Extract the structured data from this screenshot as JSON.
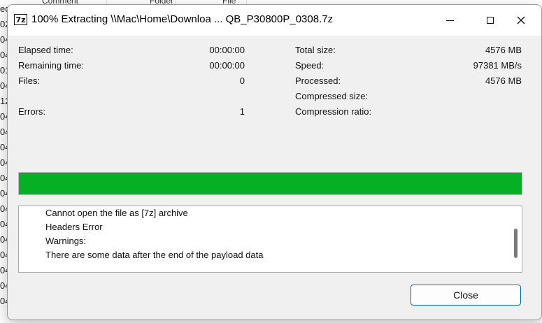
{
  "background_window": {
    "header": [
      "Comment",
      "Folder",
      "File"
    ],
    "row_fragments": [
      "ed",
      "02",
      "04",
      "04",
      "01",
      "04",
      "12",
      "04",
      "04",
      "04",
      "04",
      "04",
      "04",
      "04",
      "04",
      "04",
      "04",
      "04",
      "04",
      "04"
    ]
  },
  "dialog": {
    "app_icon": "7z",
    "title": "100% Extracting \\\\Mac\\Home\\Downloa ... QB_P30800P_0308.7z",
    "window_controls": {
      "minimize": "minimize-icon",
      "maximize": "maximize-icon",
      "close": "✕"
    },
    "left_stats": [
      {
        "label": "Elapsed time:",
        "value": "00:00:00"
      },
      {
        "label": "Remaining time:",
        "value": "00:00:00"
      },
      {
        "label": "Files:",
        "value": "0"
      },
      {
        "label": "",
        "value": ""
      },
      {
        "label": "Errors:",
        "value": "1"
      }
    ],
    "right_stats": [
      {
        "label": "Total size:",
        "value": "4576 MB"
      },
      {
        "label": "Speed:",
        "value": "97381 MB/s"
      },
      {
        "label": "Processed:",
        "value": "4576 MB"
      },
      {
        "label": "Compressed size:",
        "value": ""
      },
      {
        "label": "Compression ratio:",
        "value": ""
      }
    ],
    "progress": 1.0,
    "progress_color": "#06b025",
    "log_lines": [
      "Cannot open the file as [7z] archive",
      "Headers Error",
      "Warnings:",
      "There are some data after the end of the payload data"
    ],
    "close_button": "Close",
    "accent_color": "#0067c0"
  }
}
